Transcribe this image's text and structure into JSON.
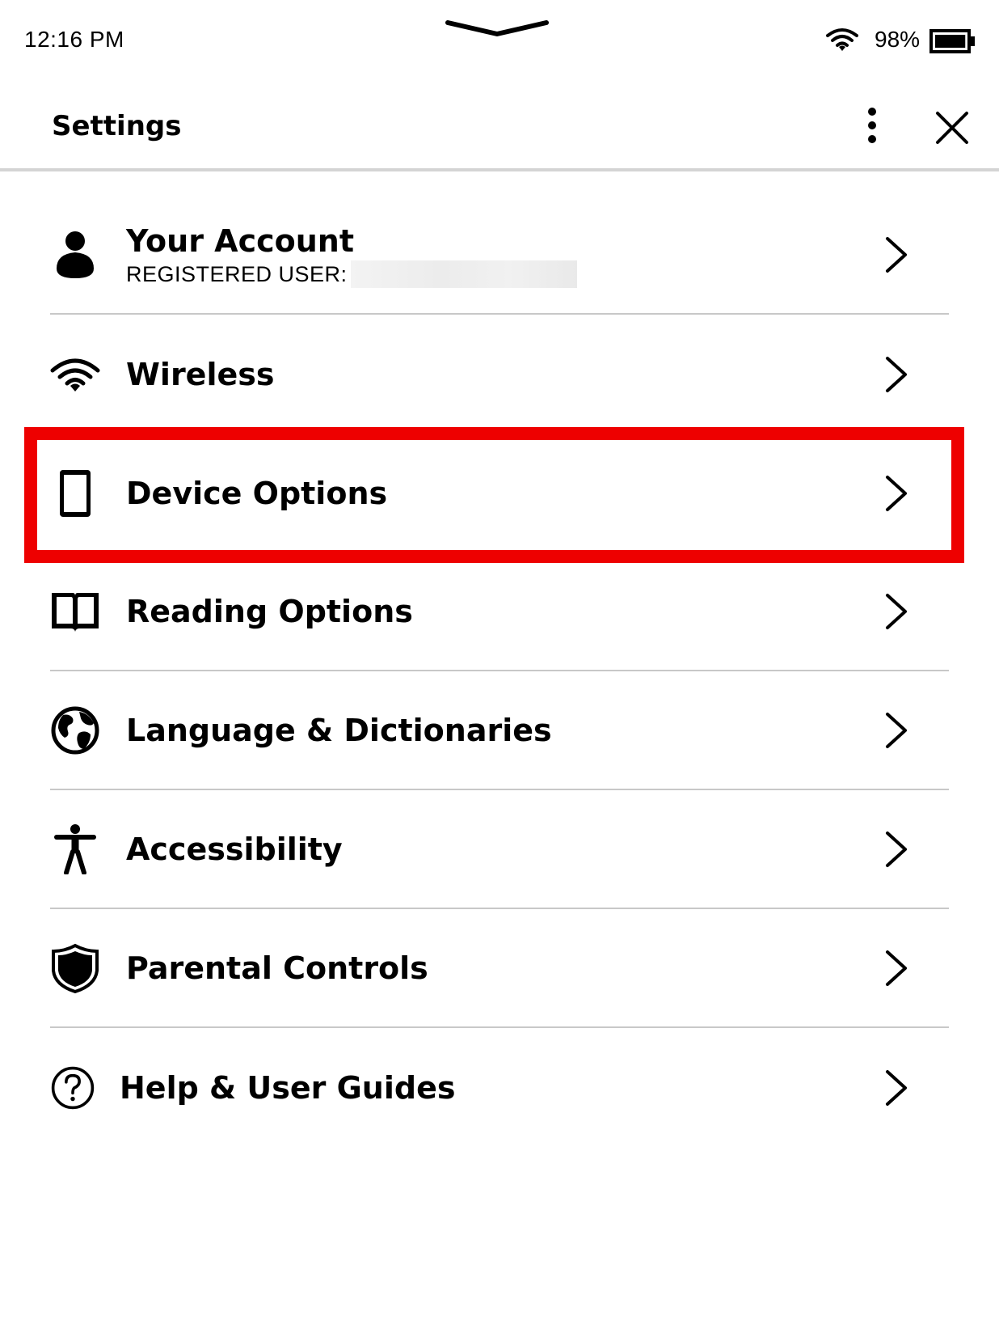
{
  "status_bar": {
    "time": "12:16 PM",
    "battery_percent": "98%",
    "battery_level": 0.98,
    "wifi_icon": "wifi-icon",
    "pulldown_icon": "pulldown-handle-icon"
  },
  "header": {
    "title": "Settings",
    "more_icon": "more-vertical-icon",
    "close_icon": "close-icon"
  },
  "settings": [
    {
      "label": "Your Account",
      "sublabel": "REGISTERED USER:",
      "icon": "person-icon"
    },
    {
      "label": "Wireless",
      "icon": "wifi-icon"
    },
    {
      "label": "Device Options",
      "icon": "device-icon"
    },
    {
      "label": "Reading Options",
      "icon": "book-icon"
    },
    {
      "label": "Language & Dictionaries",
      "icon": "globe-icon"
    },
    {
      "label": "Accessibility",
      "icon": "accessibility-icon"
    },
    {
      "label": "Parental Controls",
      "icon": "shield-icon"
    },
    {
      "label": "Help & User Guides",
      "icon": "help-icon"
    }
  ],
  "colors": {
    "highlight": "#ee0000",
    "divider": "#c8c8c8",
    "text": "#000000",
    "background": "#ffffff"
  }
}
